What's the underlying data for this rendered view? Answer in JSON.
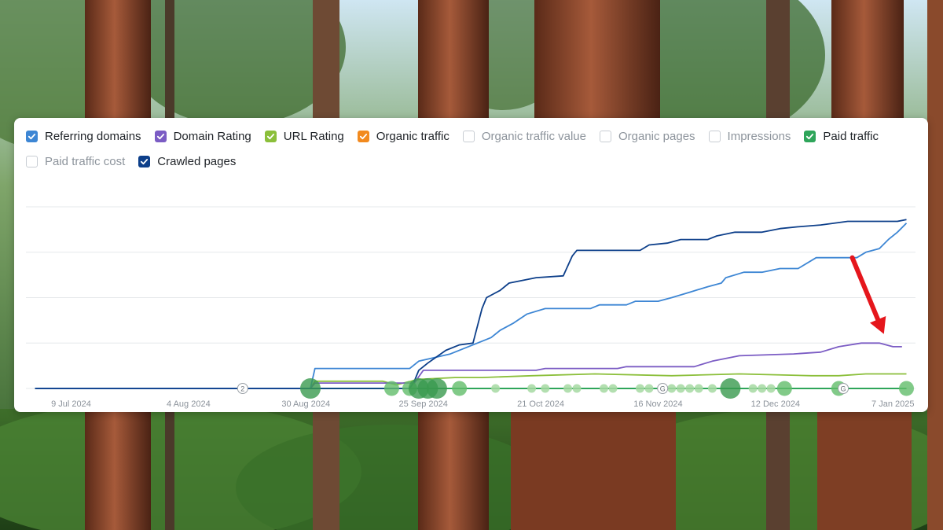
{
  "legend": [
    {
      "label": "Referring domains",
      "checked": true,
      "color": "#3d86d4"
    },
    {
      "label": "Domain Rating",
      "checked": true,
      "color": "#7b5cc4"
    },
    {
      "label": "URL Rating",
      "checked": true,
      "color": "#8bbf3a"
    },
    {
      "label": "Organic traffic",
      "checked": true,
      "color": "#f28a1e"
    },
    {
      "label": "Organic traffic value",
      "checked": false,
      "color": "#ffffff"
    },
    {
      "label": "Organic pages",
      "checked": false,
      "color": "#ffffff"
    },
    {
      "label": "Impressions",
      "checked": false,
      "color": "#ffffff"
    },
    {
      "label": "Paid traffic",
      "checked": true,
      "color": "#2ea55a"
    },
    {
      "label": "Paid traffic cost",
      "checked": false,
      "color": "#ffffff"
    },
    {
      "label": "Crawled pages",
      "checked": true,
      "color": "#0d3f8a"
    }
  ],
  "chart_data": {
    "type": "line",
    "x_tick_labels": [
      "9 Jul 2024",
      "4 Aug 2024",
      "30 Aug 2024",
      "25 Sep 2024",
      "21 Oct 2024",
      "16 Nov 2024",
      "12 Dec 2024",
      "7 Jan 2025"
    ],
    "xlim": [
      "2024-06-29",
      "2025-01-12"
    ],
    "ylim": [
      0,
      100
    ],
    "grid": true,
    "series": [
      {
        "name": "Crawled pages",
        "color": "#0d3f8a",
        "points": [
          [
            "2024-07-01",
            0
          ],
          [
            "2024-09-22",
            0
          ],
          [
            "2024-09-23",
            4
          ],
          [
            "2024-09-24",
            10
          ],
          [
            "2024-09-26",
            14
          ],
          [
            "2024-09-30",
            21
          ],
          [
            "2024-10-03",
            24
          ],
          [
            "2024-10-06",
            25
          ],
          [
            "2024-10-08",
            44
          ],
          [
            "2024-10-09",
            50
          ],
          [
            "2024-10-12",
            54
          ],
          [
            "2024-10-14",
            58
          ],
          [
            "2024-10-20",
            61
          ],
          [
            "2024-10-26",
            62
          ],
          [
            "2024-10-28",
            73
          ],
          [
            "2024-10-29",
            76
          ],
          [
            "2024-11-03",
            76
          ],
          [
            "2024-11-12",
            76
          ],
          [
            "2024-11-14",
            79
          ],
          [
            "2024-11-18",
            80
          ],
          [
            "2024-11-21",
            82
          ],
          [
            "2024-11-27",
            82
          ],
          [
            "2024-11-29",
            84
          ],
          [
            "2024-12-03",
            86
          ],
          [
            "2024-12-09",
            86
          ],
          [
            "2024-12-13",
            88
          ],
          [
            "2024-12-17",
            89
          ],
          [
            "2024-12-22",
            90
          ],
          [
            "2024-12-28",
            92
          ],
          [
            "2025-01-08",
            92
          ],
          [
            "2025-01-10",
            93
          ]
        ]
      },
      {
        "name": "Referring domains",
        "color": "#3d86d4",
        "points": [
          [
            "2024-07-01",
            0
          ],
          [
            "2024-08-31",
            0
          ],
          [
            "2024-09-01",
            11
          ],
          [
            "2024-09-22",
            11
          ],
          [
            "2024-09-24",
            15
          ],
          [
            "2024-10-01",
            19
          ],
          [
            "2024-10-08",
            26
          ],
          [
            "2024-10-10",
            28
          ],
          [
            "2024-10-12",
            32
          ],
          [
            "2024-10-15",
            36
          ],
          [
            "2024-10-18",
            41
          ],
          [
            "2024-10-22",
            44
          ],
          [
            "2024-10-28",
            44
          ],
          [
            "2024-11-01",
            44
          ],
          [
            "2024-11-03",
            46
          ],
          [
            "2024-11-09",
            46
          ],
          [
            "2024-11-11",
            48
          ],
          [
            "2024-11-16",
            48
          ],
          [
            "2024-11-19",
            50
          ],
          [
            "2024-11-23",
            53
          ],
          [
            "2024-11-27",
            56
          ],
          [
            "2024-11-30",
            58
          ],
          [
            "2024-12-01",
            61
          ],
          [
            "2024-12-05",
            64
          ],
          [
            "2024-12-09",
            64
          ],
          [
            "2024-12-13",
            66
          ],
          [
            "2024-12-17",
            66
          ],
          [
            "2024-12-21",
            72
          ],
          [
            "2024-12-26",
            72
          ],
          [
            "2024-12-30",
            72
          ],
          [
            "2025-01-01",
            75
          ],
          [
            "2025-01-04",
            77
          ],
          [
            "2025-01-06",
            82
          ],
          [
            "2025-01-08",
            86
          ],
          [
            "2025-01-10",
            91
          ]
        ]
      },
      {
        "name": "Domain Rating",
        "color": "#7b5cc4",
        "points": [
          [
            "2024-07-01",
            0
          ],
          [
            "2024-08-31",
            0
          ],
          [
            "2024-09-01",
            3
          ],
          [
            "2024-09-23",
            3
          ],
          [
            "2024-09-25",
            10
          ],
          [
            "2024-10-20",
            10
          ],
          [
            "2024-10-22",
            11
          ],
          [
            "2024-11-07",
            11
          ],
          [
            "2024-11-09",
            12
          ],
          [
            "2024-11-24",
            12
          ],
          [
            "2024-11-28",
            15
          ],
          [
            "2024-12-04",
            18
          ],
          [
            "2024-12-16",
            19
          ],
          [
            "2024-12-22",
            20
          ],
          [
            "2024-12-26",
            23
          ],
          [
            "2024-12-31",
            25
          ],
          [
            "2025-01-04",
            25
          ],
          [
            "2025-01-07",
            23
          ],
          [
            "2025-01-09",
            23
          ]
        ]
      },
      {
        "name": "URL Rating",
        "color": "#8bbf3a",
        "points": [
          [
            "2024-07-01",
            0
          ],
          [
            "2024-08-31",
            0
          ],
          [
            "2024-09-01",
            4
          ],
          [
            "2024-09-16",
            4
          ],
          [
            "2024-09-19",
            2
          ],
          [
            "2024-09-24",
            5
          ],
          [
            "2024-10-02",
            6
          ],
          [
            "2024-10-08",
            6
          ],
          [
            "2024-10-19",
            7
          ],
          [
            "2024-11-02",
            8
          ],
          [
            "2024-11-19",
            7
          ],
          [
            "2024-12-04",
            8
          ],
          [
            "2024-12-20",
            7
          ],
          [
            "2024-12-26",
            7
          ],
          [
            "2025-01-01",
            8
          ],
          [
            "2025-01-10",
            8
          ]
        ]
      },
      {
        "name": "Paid traffic",
        "color": "#2ea55a",
        "points": [
          [
            "2024-07-01",
            0
          ],
          [
            "2025-01-10",
            0
          ]
        ]
      }
    ],
    "annotation_markers": [
      {
        "date": "2024-08-16",
        "label": "2"
      },
      {
        "date": "2024-11-17",
        "label": "G"
      },
      {
        "date": "2024-12-27",
        "label": "G"
      }
    ],
    "paid_traffic_dots": [
      {
        "date": "2024-08-31",
        "size": "large"
      },
      {
        "date": "2024-09-18",
        "size": "small"
      },
      {
        "date": "2024-09-22",
        "size": "small"
      },
      {
        "date": "2024-09-24",
        "size": "large"
      },
      {
        "date": "2024-09-26",
        "size": "large"
      },
      {
        "date": "2024-09-28",
        "size": "large"
      },
      {
        "date": "2024-10-03",
        "size": "small"
      },
      {
        "date": "2024-10-11",
        "size": "tiny"
      },
      {
        "date": "2024-10-19",
        "size": "tiny"
      },
      {
        "date": "2024-10-22",
        "size": "tiny"
      },
      {
        "date": "2024-10-27",
        "size": "tiny"
      },
      {
        "date": "2024-10-29",
        "size": "tiny"
      },
      {
        "date": "2024-11-04",
        "size": "tiny"
      },
      {
        "date": "2024-11-06",
        "size": "tiny"
      },
      {
        "date": "2024-11-12",
        "size": "tiny"
      },
      {
        "date": "2024-11-14",
        "size": "tiny"
      },
      {
        "date": "2024-11-19",
        "size": "tiny"
      },
      {
        "date": "2024-11-21",
        "size": "tiny"
      },
      {
        "date": "2024-11-23",
        "size": "tiny"
      },
      {
        "date": "2024-11-25",
        "size": "tiny"
      },
      {
        "date": "2024-11-28",
        "size": "tiny"
      },
      {
        "date": "2024-12-02",
        "size": "large"
      },
      {
        "date": "2024-12-07",
        "size": "tiny"
      },
      {
        "date": "2024-12-09",
        "size": "tiny"
      },
      {
        "date": "2024-12-11",
        "size": "tiny"
      },
      {
        "date": "2024-12-14",
        "size": "small"
      },
      {
        "date": "2024-12-26",
        "size": "small"
      },
      {
        "date": "2025-01-10",
        "size": "small"
      }
    ],
    "highlight_arrow": {
      "from": [
        "2024-12-29",
        72
      ],
      "to": [
        "2025-01-05",
        30
      ],
      "color": "#e5161c"
    }
  }
}
